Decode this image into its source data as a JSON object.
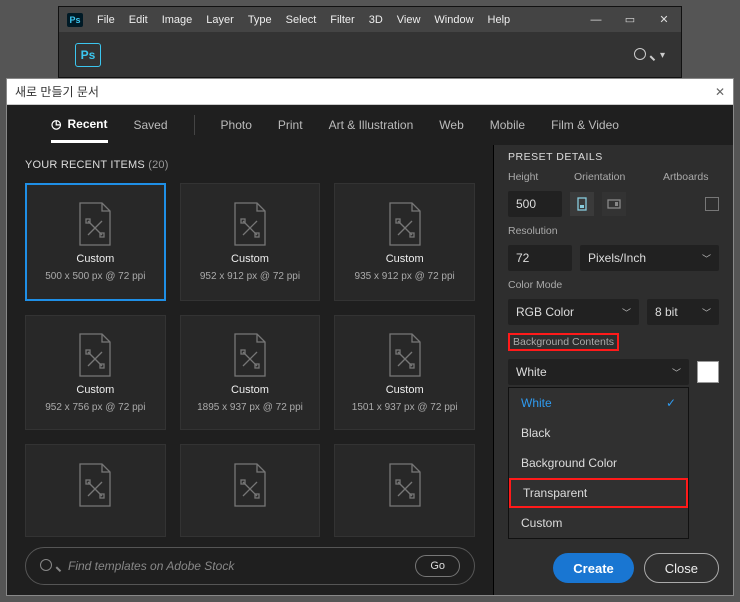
{
  "app": {
    "menus": [
      "File",
      "Edit",
      "Image",
      "Layer",
      "Type",
      "Select",
      "Filter",
      "3D",
      "View",
      "Window",
      "Help"
    ],
    "logo": "Ps"
  },
  "dialog": {
    "title": "새로 만들기 문서",
    "tabs": {
      "recent": {
        "label": "Recent",
        "icon": "clock-icon"
      },
      "saved": {
        "label": "Saved"
      },
      "photo": {
        "label": "Photo"
      },
      "print": {
        "label": "Print"
      },
      "art": {
        "label": "Art & Illustration"
      },
      "web": {
        "label": "Web"
      },
      "mobile": {
        "label": "Mobile"
      },
      "film": {
        "label": "Film & Video"
      }
    },
    "recent_header": {
      "label": "YOUR RECENT ITEMS",
      "count": "(20)"
    },
    "cards": [
      {
        "title": "Custom",
        "detail": "500 x 500 px @ 72 ppi",
        "selected": true
      },
      {
        "title": "Custom",
        "detail": "952 x 912 px @ 72 ppi"
      },
      {
        "title": "Custom",
        "detail": "935 x 912 px @ 72 ppi"
      },
      {
        "title": "Custom",
        "detail": "952 x 756 px @ 72 ppi"
      },
      {
        "title": "Custom",
        "detail": "1895 x 937 px @ 72 ppi"
      },
      {
        "title": "Custom",
        "detail": "1501 x 937 px @ 72 ppi"
      },
      {
        "title": "",
        "detail": ""
      },
      {
        "title": "",
        "detail": ""
      },
      {
        "title": "",
        "detail": ""
      }
    ],
    "search": {
      "placeholder": "Find templates on Adobe Stock",
      "go": "Go"
    },
    "preset": {
      "title": "PRESET DETAILS",
      "height_lbl": "Height",
      "height_val": "500",
      "orient_lbl": "Orientation",
      "artboards_lbl": "Artboards",
      "res_lbl": "Resolution",
      "res_val": "72",
      "res_unit": "Pixels/Inch",
      "mode_lbl": "Color Mode",
      "mode_val": "RGB Color",
      "depth_val": "8 bit",
      "bg_lbl": "Background Contents",
      "bg_val": "White",
      "bg_options": [
        "White",
        "Black",
        "Background Color",
        "Transparent",
        "Custom"
      ],
      "bg_selected": "White",
      "bg_highlight": "Transparent"
    },
    "buttons": {
      "create": "Create",
      "close": "Close"
    }
  }
}
